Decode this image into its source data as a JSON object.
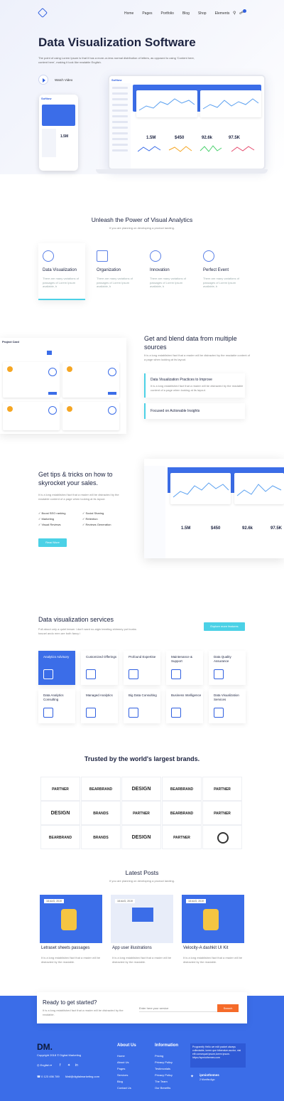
{
  "nav": {
    "items": [
      "Home",
      "Pages",
      "Portfolio",
      "Blog",
      "Shop",
      "Elements"
    ],
    "cart_count": "0"
  },
  "hero": {
    "title": "Data Visualization Software",
    "subtitle": "The point of using Lorem Ipsum is that it has a more-or-less normal distribution of letters, as opposed to using 'Content here, content here', making it look like readable English.",
    "watch": "Watch Video",
    "phone_brand": "Softiow",
    "phone_stat": "1.5M",
    "laptop_brand": "Softiow",
    "stats": [
      "1.5M",
      "$450",
      "92.6k",
      "97.5K"
    ]
  },
  "unleash": {
    "title": "Unleash the Power of Visual Analytics",
    "subtitle": "If you are planning on developing a product landing.",
    "features": [
      {
        "name": "Data Visualization",
        "desc": "There are many variations of passages of Lorem Ipsum available, b"
      },
      {
        "name": "Organization",
        "desc": "There are many variations of passages of Lorem Ipsum available, b"
      },
      {
        "name": "Innovation",
        "desc": "There are many variations of passages of Lorem Ipsum available, b"
      },
      {
        "name": "Perfect Event",
        "desc": "There are many variations of passages of Lorem Ipsum available, b"
      }
    ]
  },
  "blend": {
    "title": "Get and blend data from multiple sources",
    "text": "It is a long established fact that a reader will be distracted by the readable content of a page when looking at its layout.",
    "box1_title": "Data Visualization Practices to Improve",
    "box1_text": "It is a long established fact that a reader will be distracted by the readable content of a page when looking at its layout.",
    "box2_title": "Focused on Actionable Insights",
    "board_title": "Project Card"
  },
  "tips": {
    "title": "Get tips & tricks on how to skyrocket your sales.",
    "text": "It is a long established fact that a reader will be distracted by the readable content of a page when looking at its layout.",
    "list": [
      "Boost SEO ranking",
      "Social Sharing",
      "Marketing",
      "Retention",
      "Visual Reviews",
      "Reviews Generation"
    ],
    "button": "Read More",
    "stats": [
      "1.5M",
      "$450",
      "92.6k",
      "97.5K"
    ]
  },
  "services": {
    "title": "Data visualization services",
    "text": "Full about only a quiet teeuer i don't want no-stgin teeeting shimney pot bunks havuel ando men are both fancy i",
    "button": "Explore more features",
    "items": [
      "Analytics Advisory",
      "Customized Offerings",
      "Profound Expertise",
      "Maintenance & Support",
      "Data Quality Assurance",
      "Data Analytics Consulting",
      "Managed Analytics",
      "Big Data Consulting",
      "Business Intelligence",
      "Data Visualization Services"
    ]
  },
  "brands": {
    "title": "Trusted by the world's largest brands.",
    "items": [
      "PARTNER",
      "BEARBRAND",
      "DESIGN",
      "BEARBRAND",
      "PARTNER",
      "DESIGN",
      "BRANDS",
      "PARTNER",
      "BEARBRAND",
      "PARTNER",
      "BEARBRAND",
      "BRANDS",
      "DESIGN",
      "PARTNER",
      ""
    ]
  },
  "posts": {
    "title": "Latest Posts",
    "subtitle": "If you are planning on developing a product landing.",
    "items": [
      {
        "date": "18 AUG, 2019",
        "title": "Letraset sheets passages",
        "excerpt": "It is a long established fact that a reader will be distracted by the readable."
      },
      {
        "date": "18 AUG, 2019",
        "title": "App user illustrations",
        "excerpt": "It is a long established fact that a reader will be distracted by the readable."
      },
      {
        "date": "18 AUG, 2019",
        "title": "Velocity-A dashkit UI Kit",
        "excerpt": "It is a long established fact that a reader will be distracted by the readable."
      }
    ]
  },
  "ready": {
    "title": "Ready to get started?",
    "text": "It is a long established fact that a reader will be distracted by the readable.",
    "placeholder": "Enter here your service",
    "button": "Search"
  },
  "footer": {
    "logo": "DM.",
    "copyright": "Copyright 2018 © Digital Marketing",
    "lang": "English",
    "phone": "0 123 456 789",
    "mail": "Mail@digitalmarketing.com",
    "about_title": "About Us",
    "about_links": [
      "Home",
      "About Us",
      "Pages",
      "Services",
      "Blog",
      "Contact Us"
    ],
    "info_title": "Information",
    "info_links": [
      "Pricing",
      "Privacy Policy",
      "Testimonials",
      "Privacy Policy",
      "The Team",
      "Our Benefits"
    ],
    "tweet": "Programify Hello we edit packet always collectable, lorem que bibendum auctor, nisi elit consequat ipsum,lorem ipsum. https://spmiothemes.com",
    "tw_handle": "ipmiothemes",
    "tw_time": "2 Months Ago"
  }
}
